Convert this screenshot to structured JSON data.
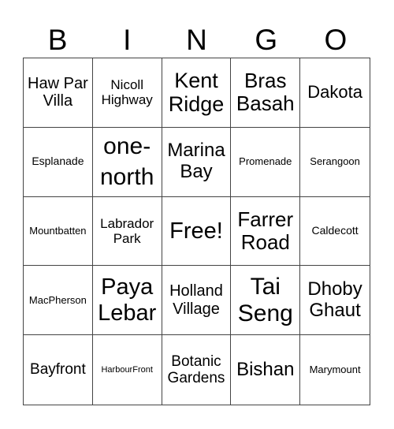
{
  "header": [
    "B",
    "I",
    "N",
    "G",
    "O"
  ],
  "cells": [
    [
      "Haw Par Villa",
      "Nicoll Highway",
      "Kent Ridge",
      "Bras Basah",
      "Dakota"
    ],
    [
      "Esplanade",
      "one-north",
      "Marina Bay",
      "Promenade",
      "Serangoon"
    ],
    [
      "Mountbatten",
      "Labrador Park",
      "Free!",
      "Farrer Road",
      "Caldecott"
    ],
    [
      "MacPherson",
      "Paya Lebar",
      "Holland Village",
      "Tai Seng",
      "Dhoby Ghaut"
    ],
    [
      "Bayfront",
      "HarbourFront",
      "Botanic Gardens",
      "Bishan",
      "Marymount"
    ]
  ]
}
